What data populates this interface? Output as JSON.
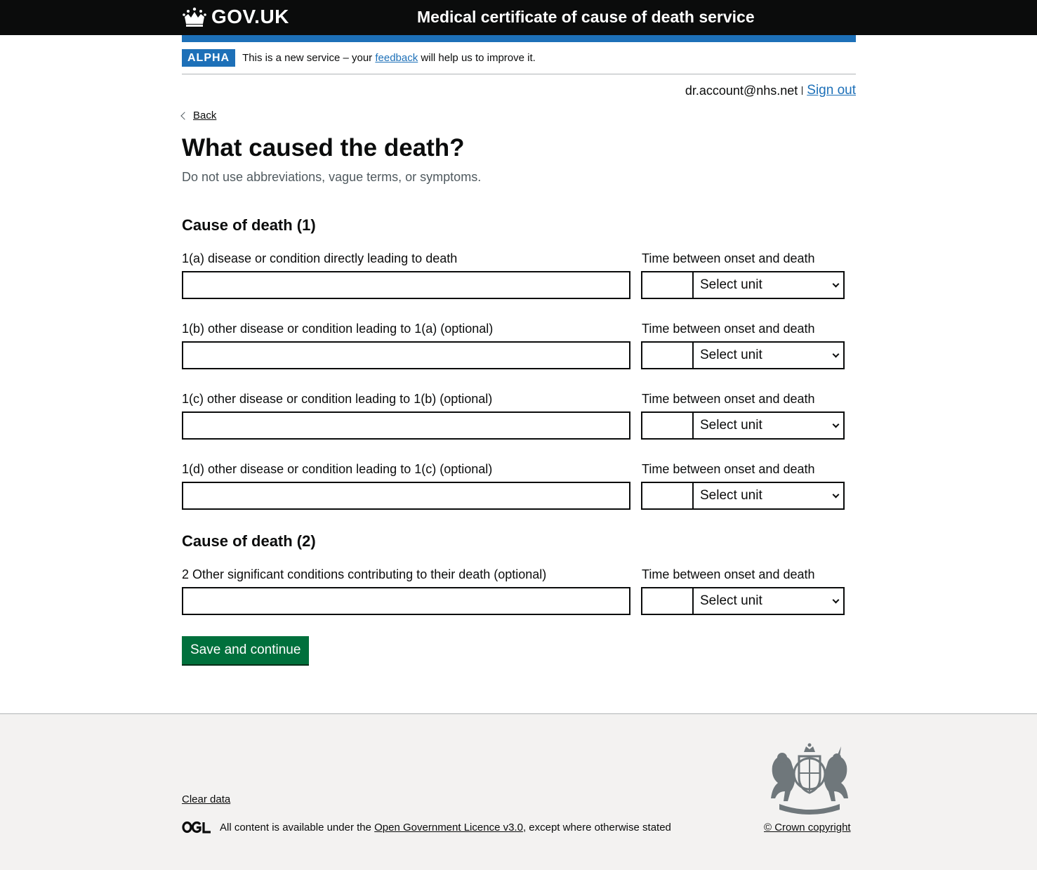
{
  "header": {
    "logo_text": "GOV.UK",
    "service_name": "Medical certificate of cause of death service"
  },
  "phase": {
    "tag": "ALPHA",
    "text_before": "This is a new service – your ",
    "link": "feedback",
    "text_after": " will help us to improve it."
  },
  "account": {
    "email": "dr.account@nhs.net",
    "sign_out": "Sign out"
  },
  "back_link": "Back",
  "page": {
    "title": "What caused the death?",
    "hint": "Do not use abbreviations, vague terms, or symptoms."
  },
  "sections": {
    "cause1_heading": "Cause of death (1)",
    "cause2_heading": "Cause of death (2)"
  },
  "fields": [
    {
      "label": "1(a) disease or condition directly leading to death",
      "time_label": "Time between onset and death",
      "value": "",
      "time_value": "",
      "unit": "Select unit"
    },
    {
      "label": "1(b) other disease or condition leading to 1(a) (optional)",
      "time_label": "Time between onset and death",
      "value": "",
      "time_value": "",
      "unit": "Select unit"
    },
    {
      "label": "1(c) other disease or condition leading to 1(b) (optional)",
      "time_label": "Time between onset and death",
      "value": "",
      "time_value": "",
      "unit": "Select unit"
    },
    {
      "label": "1(d) other disease or condition leading to 1(c) (optional)",
      "time_label": "Time between onset and death",
      "value": "",
      "time_value": "",
      "unit": "Select unit"
    },
    {
      "label": "2 Other significant conditions contributing to their death (optional)",
      "time_label": "Time between onset and death",
      "value": "",
      "time_value": "",
      "unit": "Select unit"
    }
  ],
  "actions": {
    "save": "Save and continue"
  },
  "footer": {
    "clear_data": "Clear data",
    "licence_before": "All content is available under the ",
    "licence_link": "Open Government Licence v3.0",
    "licence_after": ", except where otherwise stated",
    "crown_copyright": "© Crown copyright"
  },
  "colors": {
    "header_bg": "#0b0c0c",
    "brand_blue": "#1d70b8",
    "button_green": "#00703c",
    "footer_bg": "#f3f2f1"
  }
}
